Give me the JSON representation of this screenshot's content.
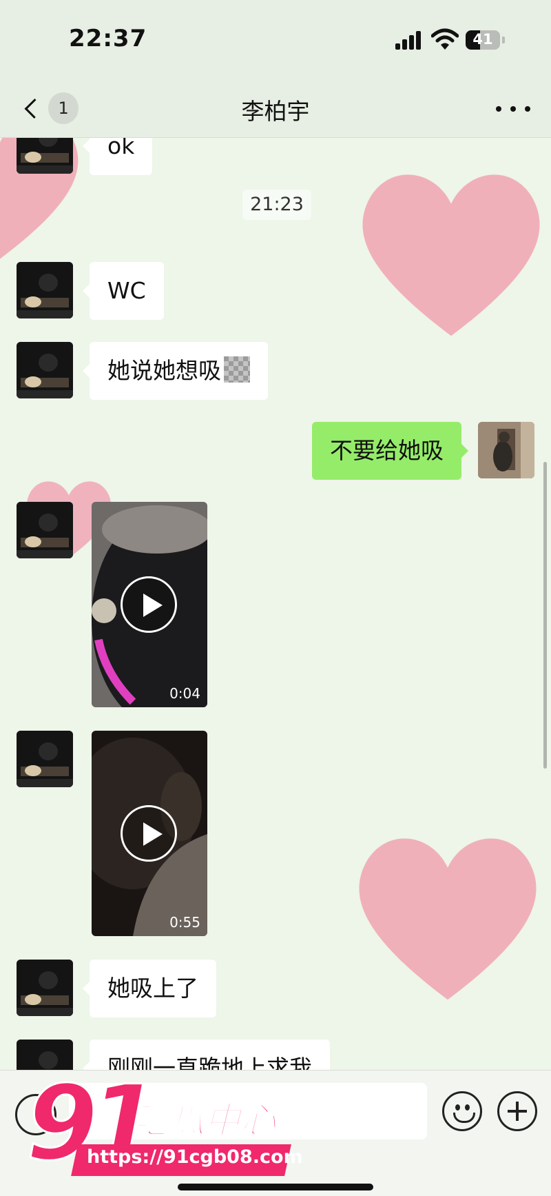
{
  "status_bar": {
    "time": "22:37",
    "battery_level": "41"
  },
  "nav": {
    "unread_count": "1",
    "title": "李柏宇"
  },
  "messages": {
    "m0_text": "ok",
    "timestamp": "21:23",
    "m1_text": "WC",
    "m2_text": "她说她想吸",
    "m3_text": "不要给她吸",
    "v1_duration": "0:04",
    "v2_duration": "0:55",
    "m6_text": "她吸上了",
    "m7_text": "刚刚一直跪地上求我"
  },
  "watermark": {
    "number": "91",
    "brand": "吃瓜中心",
    "url": "https://91cgb08.com"
  },
  "icons": [
    "back-chevron-icon",
    "more-icon",
    "play-icon",
    "voice-icon",
    "emoji-icon",
    "add-icon",
    "signal-icon",
    "wifi-icon",
    "battery-icon"
  ],
  "colors": {
    "chat_background": "#eef5e9",
    "bubble_incoming": "#ffffff",
    "bubble_outgoing": "#95ec69",
    "heart": "#f0a3b2",
    "watermark": "#f0286c"
  }
}
